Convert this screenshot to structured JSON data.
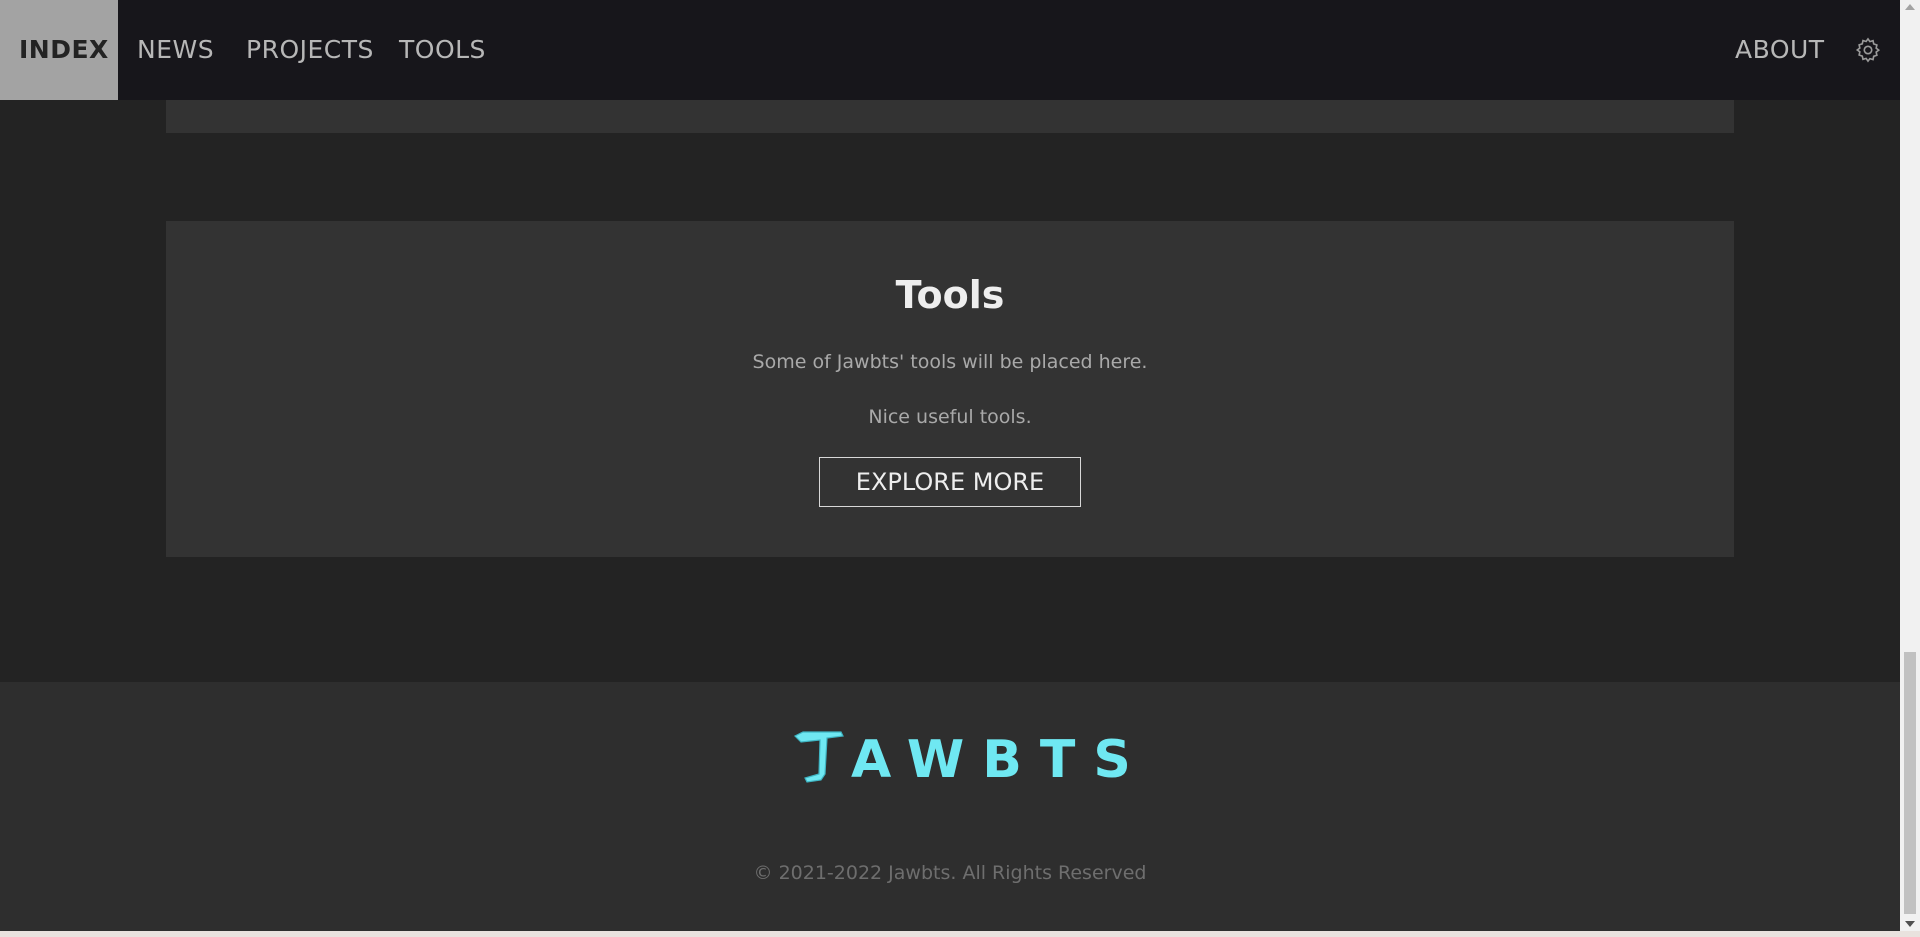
{
  "nav": {
    "items": [
      {
        "label": "INDEX",
        "active": true
      },
      {
        "label": "NEWS"
      },
      {
        "label": "PROJECTS"
      },
      {
        "label": "TOOLS"
      }
    ],
    "about_label": "ABOUT",
    "settings_icon": "gear-icon"
  },
  "tools_section": {
    "title": "Tools",
    "line1": "Some of Jawbts' tools will be placed here.",
    "line2": "Nice useful tools.",
    "button_label": "EXPLORE MORE"
  },
  "footer": {
    "logo_text": "AWBTS",
    "logo_color": "#6fe8f2",
    "copyright": "© 2021-2022 Jawbts. All Rights Reserved"
  }
}
